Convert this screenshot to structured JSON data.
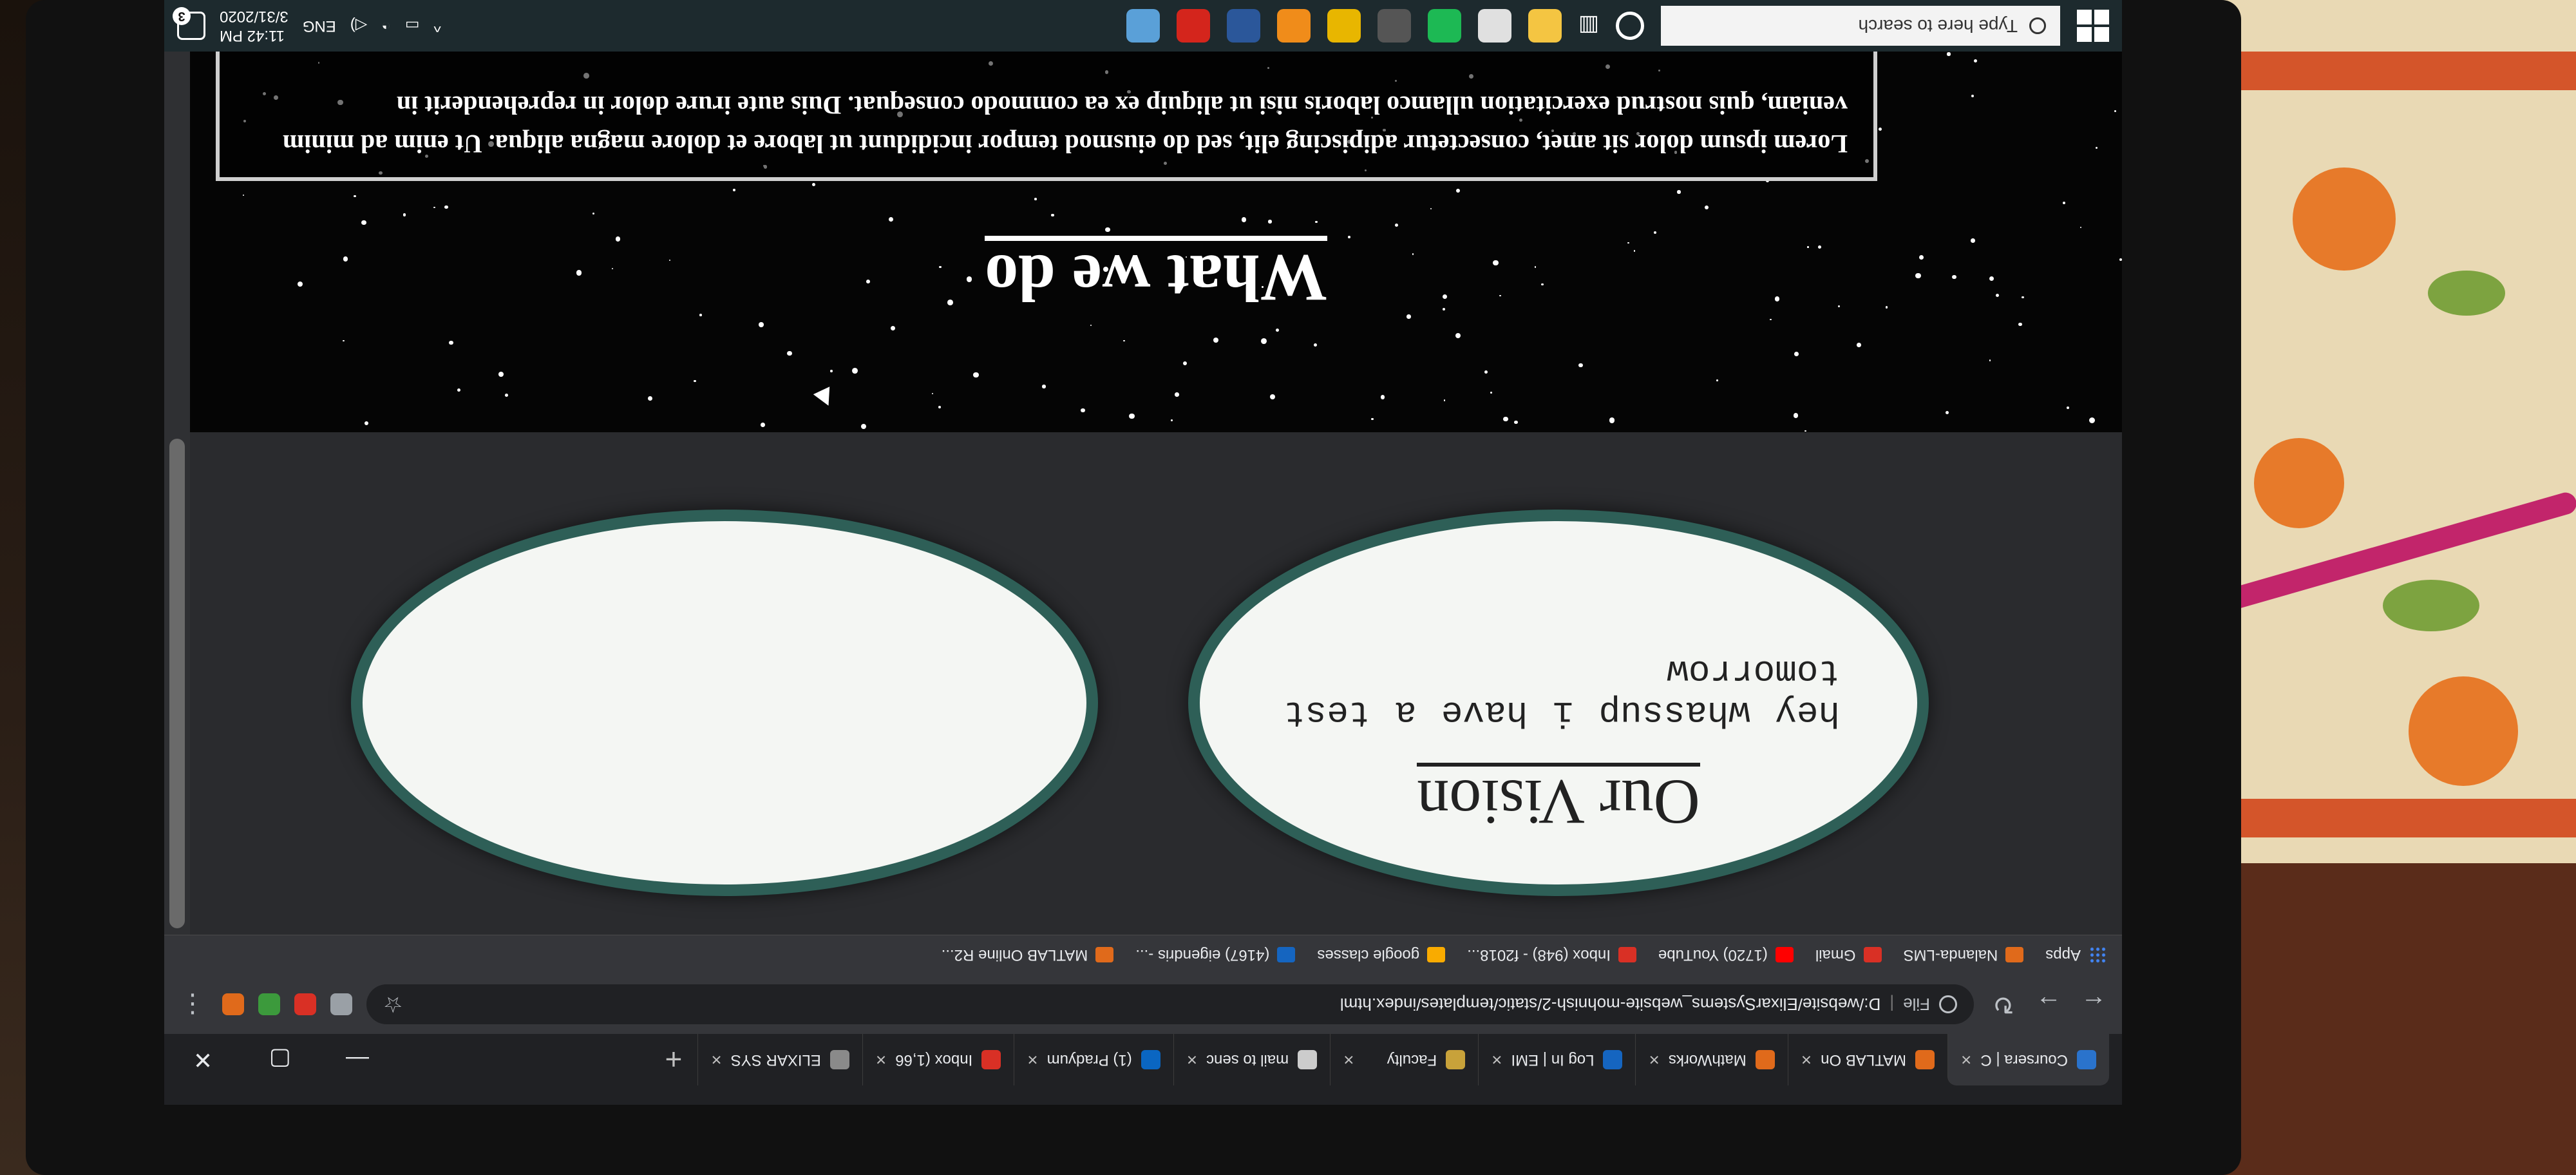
{
  "tabs": [
    {
      "label": "Coursera | C",
      "color": "#2a73cc"
    },
    {
      "label": "MATLAB On",
      "color": "#e06a1b"
    },
    {
      "label": "MathWorks",
      "color": "#e06a1b"
    },
    {
      "label": "Log In | EMI",
      "color": "#1565c0"
    },
    {
      "label": "Faculty",
      "color": "#c8a23a"
    },
    {
      "label": "mail to senc",
      "color": "#cccccc"
    },
    {
      "label": "(1) Pradyum",
      "color": "#0a66c2"
    },
    {
      "label": "Inbox (1,66",
      "color": "#d93025"
    },
    {
      "label": "ELIXAR SYS",
      "color": "#8a8a8a"
    }
  ],
  "new_tab_symbol": "+",
  "window_controls": {
    "minimize": "—",
    "maximize": "▢",
    "close": "✕"
  },
  "address_bar": {
    "scheme": "File",
    "url": "D:/website/ElixarSystems_website-mohnish-2/static/templates/index.html"
  },
  "bookmarks": [
    {
      "label": "Apps",
      "icon": "apps-grid-icon"
    },
    {
      "label": "Nalanda-LMS",
      "color": "#e06a1b"
    },
    {
      "label": "Gmail",
      "color": "#d93025"
    },
    {
      "label": "(1720) YouTube",
      "color": "#ff0000"
    },
    {
      "label": "Inbox (948) - f2018...",
      "color": "#d93025"
    },
    {
      "label": "google classes",
      "color": "#f9ab00"
    },
    {
      "label": "(4167) eigendris -...",
      "color": "#1565c0"
    },
    {
      "label": "MATLAB Online R2...",
      "color": "#e06a1b"
    }
  ],
  "cards": [
    {
      "title": "Our Vision",
      "text": "hey whassup i have a test tomorrow"
    },
    {
      "title": "",
      "text": ""
    }
  ],
  "section_title": "What we do",
  "lorem": "Lorem ipsum dolor sit amet, consectetur adipiscing elit, sed do eiusmod tempor incididunt ut labore et dolore magna aliqua. Ut enim ad minim veniam, quis nostrud exercitation ullamco laboris nisi ut aliquip ex ea commodo consequat. Duis aute irure dolor in reprehenderit in",
  "taskbar": {
    "search_placeholder": "Type here to search",
    "apps": [
      {
        "name": "file-explorer-icon",
        "color": "#f4c542"
      },
      {
        "name": "store-icon",
        "color": "#e0e0e0"
      },
      {
        "name": "spotify-icon",
        "color": "#1db954"
      },
      {
        "name": "webcam-icon",
        "color": "#555555"
      },
      {
        "name": "chrome-icon",
        "color": "#e8b600"
      },
      {
        "name": "sublime-icon",
        "color": "#f08c1a"
      },
      {
        "name": "word-icon",
        "color": "#2b579a"
      },
      {
        "name": "acrobat-icon",
        "color": "#d4251c"
      },
      {
        "name": "photos-icon",
        "color": "#5aa0d8"
      }
    ],
    "language": "ENG",
    "time": "11:42 PM",
    "date": "3/31/2020",
    "notifications": "3"
  }
}
